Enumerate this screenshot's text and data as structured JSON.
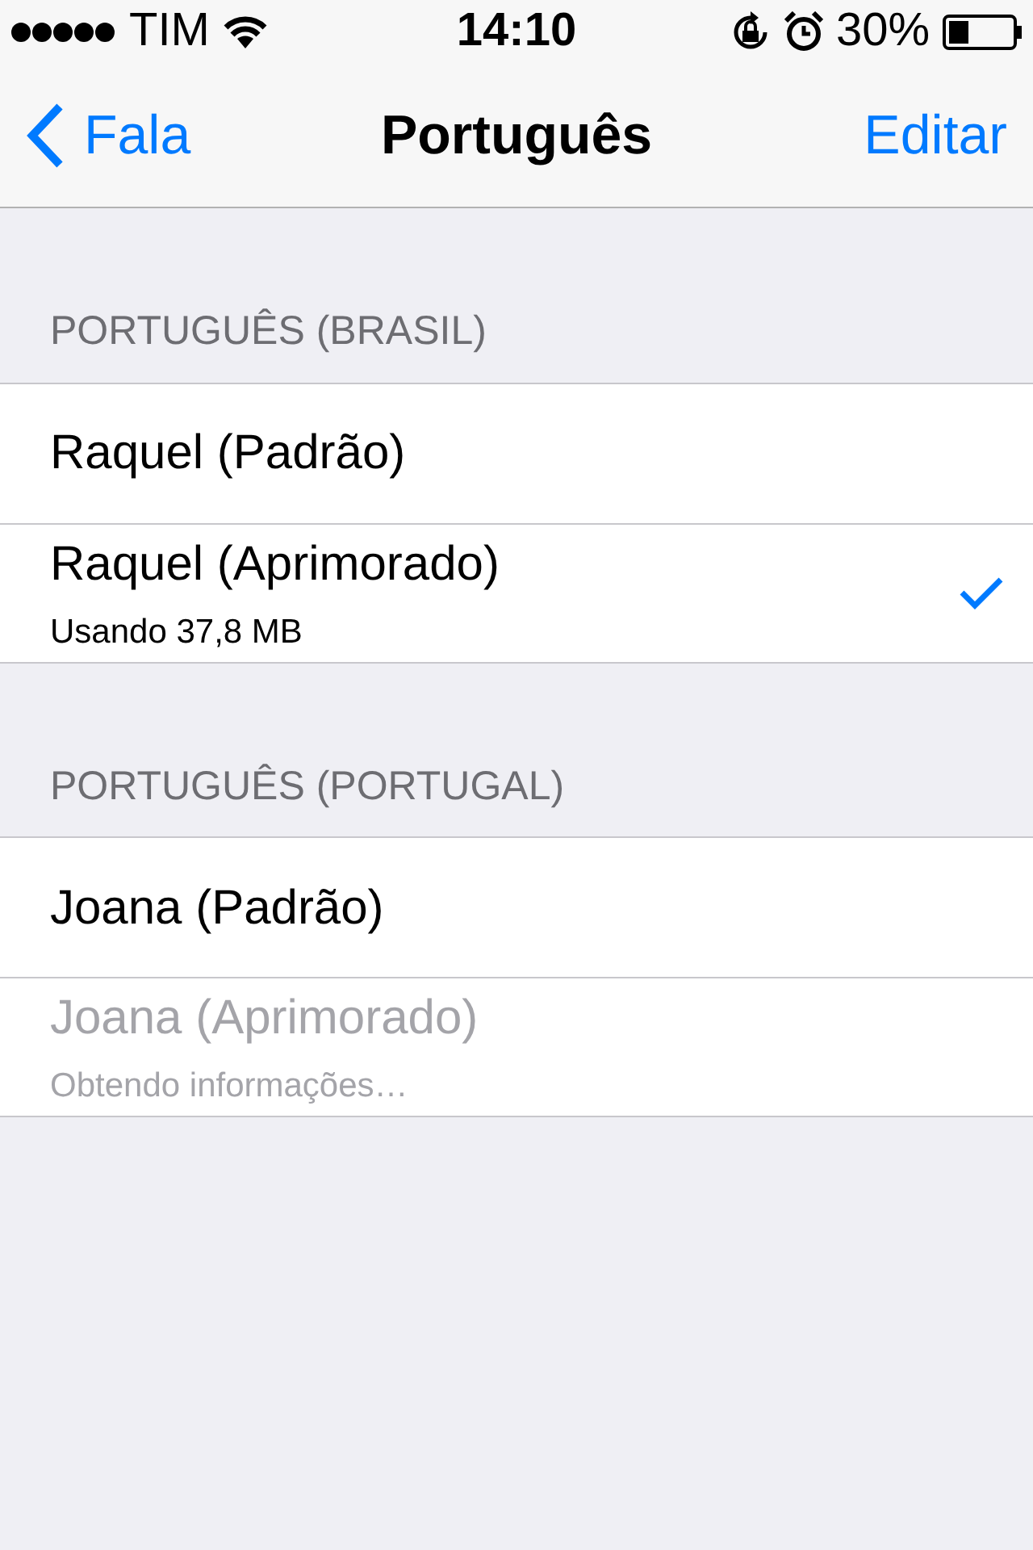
{
  "status_bar": {
    "carrier": "TIM",
    "time": "14:10",
    "battery": "30%"
  },
  "nav": {
    "back": "Fala",
    "title": "Português",
    "action": "Editar"
  },
  "sections": [
    {
      "header": "PORTUGUÊS (BRASIL)",
      "items": [
        {
          "name": "Raquel (Padrão)",
          "checked": false,
          "disabled": false
        },
        {
          "name": "Raquel (Aprimorado)",
          "subtitle": "Usando 37,8 MB",
          "checked": true,
          "disabled": false
        }
      ]
    },
    {
      "header": "PORTUGUÊS (PORTUGAL)",
      "items": [
        {
          "name": "Joana (Padrão)",
          "checked": false,
          "disabled": false
        },
        {
          "name": "Joana (Aprimorado)",
          "subtitle": "Obtendo informações…",
          "checked": false,
          "disabled": true
        }
      ]
    }
  ]
}
